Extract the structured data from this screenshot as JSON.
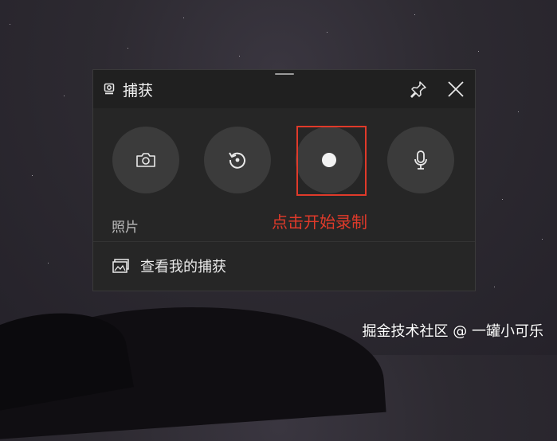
{
  "widget": {
    "title": "捕获",
    "title_icon": "camera-small-icon",
    "pin_icon": "pin-icon",
    "close_icon": "close-icon"
  },
  "actions": [
    {
      "name": "screenshot",
      "icon": "camera-icon"
    },
    {
      "name": "record-last",
      "icon": "history-icon"
    },
    {
      "name": "start-recording",
      "icon": "record-dot-icon",
      "highlighted": true
    },
    {
      "name": "microphone",
      "icon": "microphone-icon"
    }
  ],
  "mode_label": "照片",
  "annotation": "点击开始录制",
  "gallery": {
    "icon": "gallery-icon",
    "label": "查看我的捕获"
  },
  "watermark": "掘金技术社区 @ 一罐小可乐",
  "colors": {
    "panel_bg": "#262626",
    "titlebar_bg": "#202020",
    "button_bg": "#3b3b3b",
    "annotation_red": "#e03a2a"
  }
}
